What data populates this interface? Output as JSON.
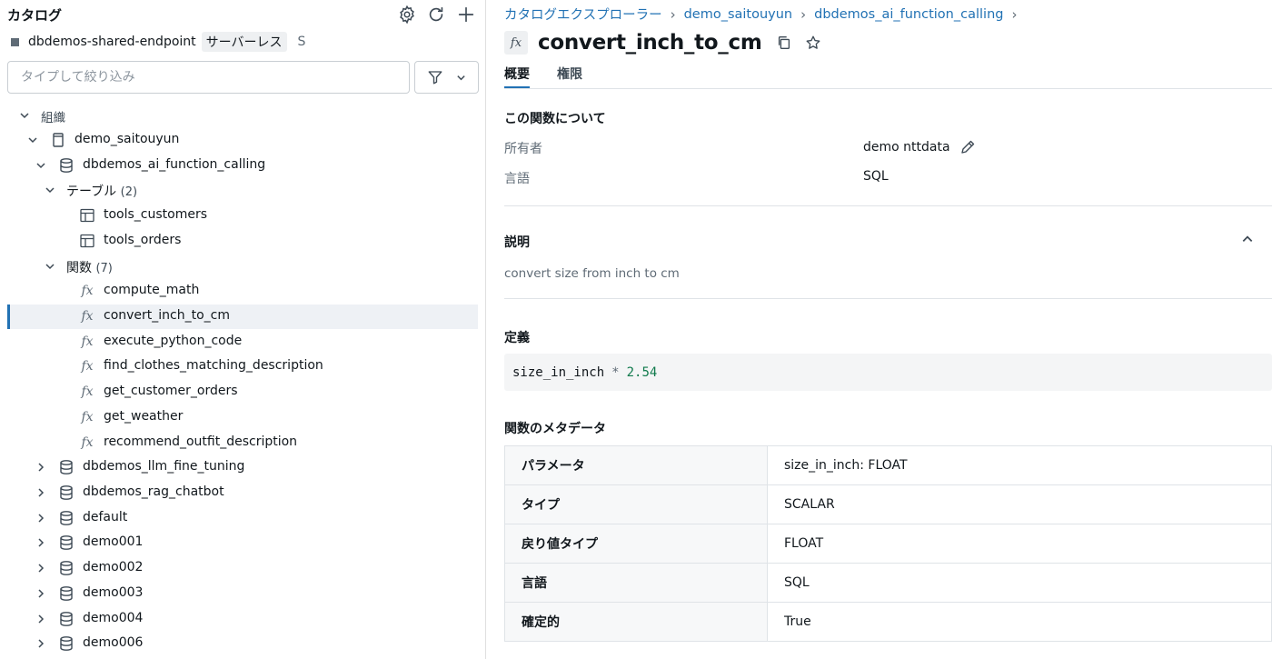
{
  "catalog": {
    "title": "カタログ",
    "icons": [
      "gear-icon",
      "refresh-icon",
      "plus-icon"
    ]
  },
  "endpoint": {
    "name": "dbdemos-shared-endpoint",
    "badge": "サーバーレス",
    "size": "S"
  },
  "filter": {
    "placeholder": "タイプして絞り込み"
  },
  "tree": {
    "org_label": "組織",
    "catalog_name": "demo_saitouyun",
    "schema_name": "dbdemos_ai_function_calling",
    "tables_label": "テーブル",
    "tables_count": "(2)",
    "tables": [
      "tools_customers",
      "tools_orders"
    ],
    "functions_label": "関数",
    "functions_count": "(7)",
    "functions": [
      "compute_math",
      "convert_inch_to_cm",
      "execute_python_code",
      "find_clothes_matching_description",
      "get_customer_orders",
      "get_weather",
      "recommend_outfit_description"
    ],
    "selected_function": "convert_inch_to_cm",
    "other_schemas": [
      "dbdemos_llm_fine_tuning",
      "dbdemos_rag_chatbot",
      "default",
      "demo001",
      "demo002",
      "demo003",
      "demo004",
      "demo006"
    ]
  },
  "breadcrumb": [
    "カタログエクスプローラー",
    "demo_saitouyun",
    "dbdemos_ai_function_calling"
  ],
  "function": {
    "fx_label": "fx",
    "name": "convert_inch_to_cm"
  },
  "tabs": [
    "概要",
    "権限"
  ],
  "about": {
    "heading": "この関数について",
    "owner_label": "所有者",
    "owner_value": "demo nttdata",
    "language_label": "言語",
    "language_value": "SQL"
  },
  "description": {
    "heading": "説明",
    "text": "convert size from inch to cm"
  },
  "definition": {
    "heading": "定義",
    "code_ident": "size_in_inch",
    "code_op": "*",
    "code_num": "2.54"
  },
  "metadata": {
    "heading": "関数のメタデータ",
    "rows": [
      {
        "key": "パラメータ",
        "value": "size_in_inch: FLOAT"
      },
      {
        "key": "タイプ",
        "value": "SCALAR"
      },
      {
        "key": "戻り値タイプ",
        "value": "FLOAT"
      },
      {
        "key": "言語",
        "value": "SQL"
      },
      {
        "key": "確定的",
        "value": "True"
      }
    ]
  },
  "colors": {
    "accent": "#2272b4",
    "selected_bg": "#eef1f5",
    "number_green": "#107a4c"
  }
}
